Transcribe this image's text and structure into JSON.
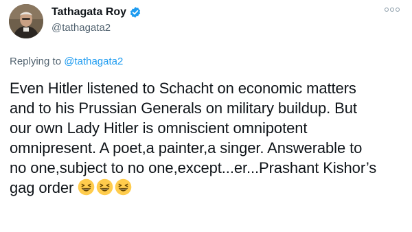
{
  "tweet": {
    "author": {
      "display_name": "Tathagata Roy",
      "handle": "@tathagata2",
      "verified": true
    },
    "replying_prefix": "Replying to ",
    "replying_to": "@tathagata2",
    "text_lines": [
      "Even Hitler listened to Schacht on economic matters",
      "and to his Prussian Generals on military buildup. But",
      "our own Lady Hitler is omniscient omnipotent",
      "omnipresent. A poet,a painter,a singer. Answerable to",
      "no one,subject to no one,except...er...Prashant Kishor’s",
      "gag order"
    ],
    "emojis": [
      "laughing-face-icon",
      "laughing-face-icon",
      "laughing-face-icon"
    ]
  },
  "colors": {
    "link": "#1d9bf0",
    "secondary_text": "#536471",
    "verified_badge": "#1d9bf0"
  }
}
